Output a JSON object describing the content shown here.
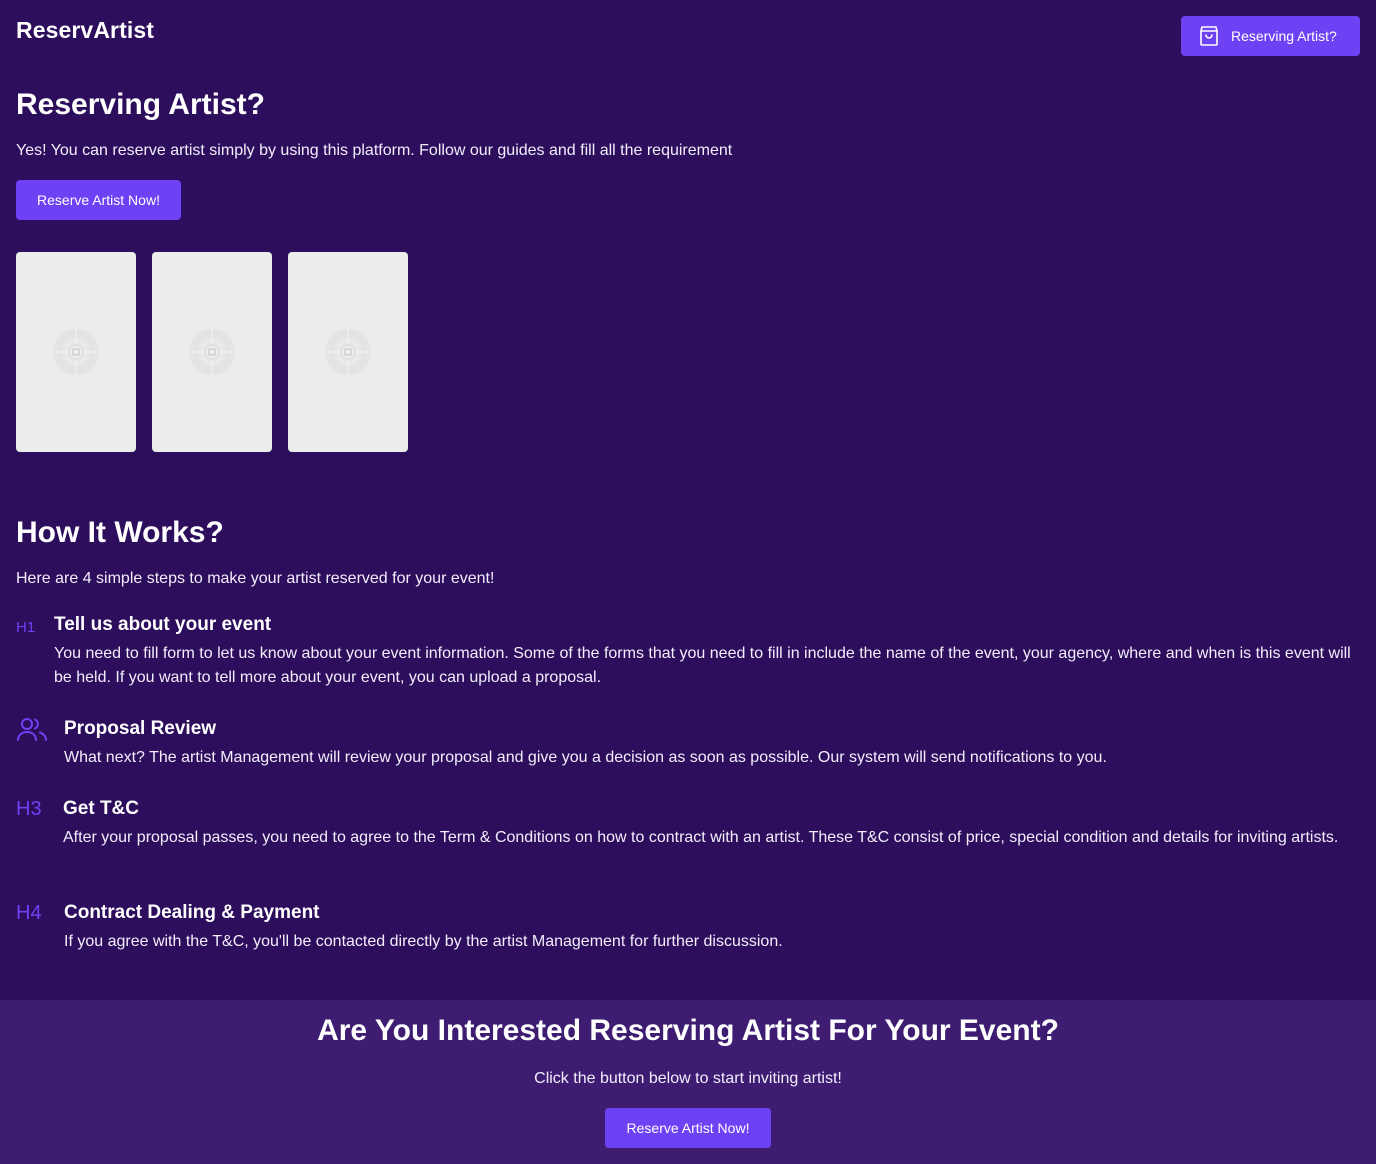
{
  "header": {
    "logo": "ReservArtist",
    "cta_label": "Reserving Artist?",
    "cta_icon": "shopping-bag-icon"
  },
  "hero": {
    "title": "Reserving Artist?",
    "description": "Yes! You can reserve artist simply by using this platform. Follow our guides and fill all the requirement",
    "button_label": "Reserve Artist Now!",
    "gallery": [
      {
        "icon": "image-placeholder-icon"
      },
      {
        "icon": "image-placeholder-icon"
      },
      {
        "icon": "image-placeholder-icon"
      }
    ]
  },
  "how": {
    "title": "How It Works?",
    "intro": "Here are 4 simple steps to make your artist reserved for your event!",
    "steps": [
      {
        "icon": "heading-1-icon",
        "icon_text": "H1",
        "title": "Tell us about your event",
        "text": "You need to fill form to let us know about your event information. Some of the forms that you need to fill in include the name of the event, your agency, where and when is this event will be held. If you want to tell more about your event, you can upload a proposal."
      },
      {
        "icon": "users-icon",
        "title": "Proposal Review",
        "text": "What next? The artist Management will review your proposal and give you a decision as soon as possible. Our system will send notifications to you."
      },
      {
        "icon": "heading-3-icon",
        "icon_text": "H3",
        "title": "Get T&C",
        "text": "After your proposal passes, you need to agree to the Term & Conditions on how to contract with an artist. These T&C consist of price, special condition and details for inviting artists."
      },
      {
        "icon": "heading-4-icon",
        "icon_text": "H4",
        "title": "Contract Dealing & Payment",
        "text": "If you agree with the T&C, you'll be contacted directly by the artist Management for further discussion."
      }
    ]
  },
  "cta": {
    "title": "Are You Interested Reserving Artist For Your Event?",
    "text": "Click the button below to start inviting artist!",
    "button_label": "Reserve Artist Now!"
  },
  "colors": {
    "background": "#2d0e5c",
    "cta_background": "#3d1c72",
    "accent": "#6d42f5",
    "placeholder": "#ececec"
  }
}
